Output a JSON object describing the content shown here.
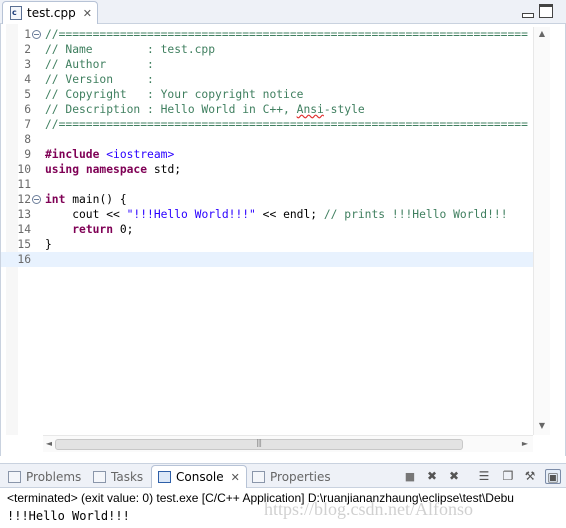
{
  "editor_tab": {
    "file_icon_letter": "c",
    "title": "test.cpp",
    "close_glyph": "✕"
  },
  "code_lines": [
    {
      "n": "1",
      "fold": true,
      "segs": [
        {
          "t": "//=====================================================================",
          "c": "c-com"
        }
      ]
    },
    {
      "n": "2",
      "fold": false,
      "segs": [
        {
          "t": "// Name        : test.cpp",
          "c": "c-com"
        }
      ]
    },
    {
      "n": "3",
      "fold": false,
      "segs": [
        {
          "t": "// Author      :",
          "c": "c-com"
        }
      ]
    },
    {
      "n": "4",
      "fold": false,
      "segs": [
        {
          "t": "// Version     :",
          "c": "c-com"
        }
      ]
    },
    {
      "n": "5",
      "fold": false,
      "segs": [
        {
          "t": "// Copyright   : Your copyright notice",
          "c": "c-com"
        }
      ]
    },
    {
      "n": "6",
      "fold": false,
      "segs": [
        {
          "t": "// Description : Hello World in C++, ",
          "c": "c-com"
        },
        {
          "t": "Ansi",
          "c": "c-com squig"
        },
        {
          "t": "-style",
          "c": "c-com"
        }
      ]
    },
    {
      "n": "7",
      "fold": false,
      "segs": [
        {
          "t": "//=====================================================================",
          "c": "c-com"
        }
      ]
    },
    {
      "n": "8",
      "fold": false,
      "segs": []
    },
    {
      "n": "9",
      "fold": false,
      "segs": [
        {
          "t": "#include",
          "c": "c-kw"
        },
        {
          "t": " ",
          "c": "c-def"
        },
        {
          "t": "<iostream>",
          "c": "c-str"
        }
      ]
    },
    {
      "n": "10",
      "fold": false,
      "segs": [
        {
          "t": "using",
          "c": "c-kw"
        },
        {
          "t": " ",
          "c": "c-def"
        },
        {
          "t": "namespace",
          "c": "c-kw"
        },
        {
          "t": " std;",
          "c": "c-def"
        }
      ]
    },
    {
      "n": "11",
      "fold": false,
      "segs": []
    },
    {
      "n": "12",
      "fold": true,
      "segs": [
        {
          "t": "int",
          "c": "c-kw"
        },
        {
          "t": " ",
          "c": "c-def"
        },
        {
          "t": "main",
          "c": "c-def"
        },
        {
          "t": "() {",
          "c": "c-def"
        }
      ]
    },
    {
      "n": "13",
      "fold": false,
      "segs": [
        {
          "t": "    cout << ",
          "c": "c-def"
        },
        {
          "t": "\"!!!Hello World!!!\"",
          "c": "c-str"
        },
        {
          "t": " << endl; ",
          "c": "c-def"
        },
        {
          "t": "// prints !!!Hello World!!!",
          "c": "c-com"
        }
      ]
    },
    {
      "n": "14",
      "fold": false,
      "segs": [
        {
          "t": "    ",
          "c": "c-def"
        },
        {
          "t": "return",
          "c": "c-kw"
        },
        {
          "t": " 0;",
          "c": "c-def"
        }
      ]
    },
    {
      "n": "15",
      "fold": false,
      "segs": [
        {
          "t": "}",
          "c": "c-def"
        }
      ]
    },
    {
      "n": "16",
      "fold": false,
      "segs": [],
      "current": true
    }
  ],
  "scroll": {
    "up": "▲",
    "down": "▼",
    "left": "◄",
    "right": "►"
  },
  "view_tabs": [
    {
      "name": "tab-problems",
      "label": "Problems",
      "active": false
    },
    {
      "name": "tab-tasks",
      "label": "Tasks",
      "active": false
    },
    {
      "name": "tab-console",
      "label": "Console",
      "active": true
    },
    {
      "name": "tab-properties",
      "label": "Properties",
      "active": false
    }
  ],
  "console_tab_close": "✕",
  "toolbar_glyphs": {
    "terminate": "■",
    "remove_launch": "✖",
    "remove_all": "✖",
    "clear": "☰",
    "scroll_lock": "❐",
    "pin": "⚒",
    "display": "▣"
  },
  "console": {
    "status": "<terminated> (exit value: 0) test.exe [C/C++ Application] D:\\ruanjiananzhaung\\eclipse\\test\\Debu",
    "output": "!!!Hello World!!!",
    "watermark": "https://blog.csdn.net/Alfonso"
  },
  "colors": {
    "comment": "#3f7f5f",
    "keyword": "#7f0055",
    "string": "#2a00ff",
    "current_line": "#e8f2fe"
  }
}
